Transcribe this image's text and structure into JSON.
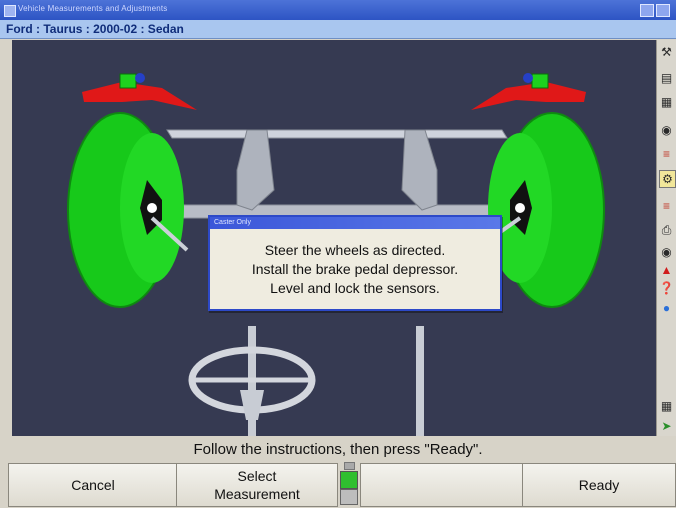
{
  "window": {
    "title": "Vehicle Measurements and Adjustments"
  },
  "vehicle": {
    "label": "Ford : Taurus : 2000-02 : Sedan"
  },
  "dialog": {
    "title": "Caster Only",
    "lines": [
      "Steer the wheels as directed.",
      "Install the brake pedal depressor.",
      "Level and lock the sensors."
    ]
  },
  "instruction": "Follow the instructions, then press \"Ready\".",
  "buttons": {
    "cancel": "Cancel",
    "select_line1": "Select",
    "select_line2": "Measurement",
    "ready": "Ready"
  },
  "sidebar_icons": [
    "wrench-icon",
    "vehicle-specs-icon",
    "sensor-icon",
    "target-icon",
    "alignment-icon",
    "caster-icon",
    "measure-icon",
    "print-icon",
    "camera-icon",
    "warning-icon",
    "help-icon",
    "globe-icon",
    "tool-icon",
    "exit-icon"
  ],
  "colors": {
    "wheel": "#19d11c",
    "caster_marker": "#e01818",
    "viewport_bg": "#363a52",
    "dialog_border": "#2d49c8"
  }
}
